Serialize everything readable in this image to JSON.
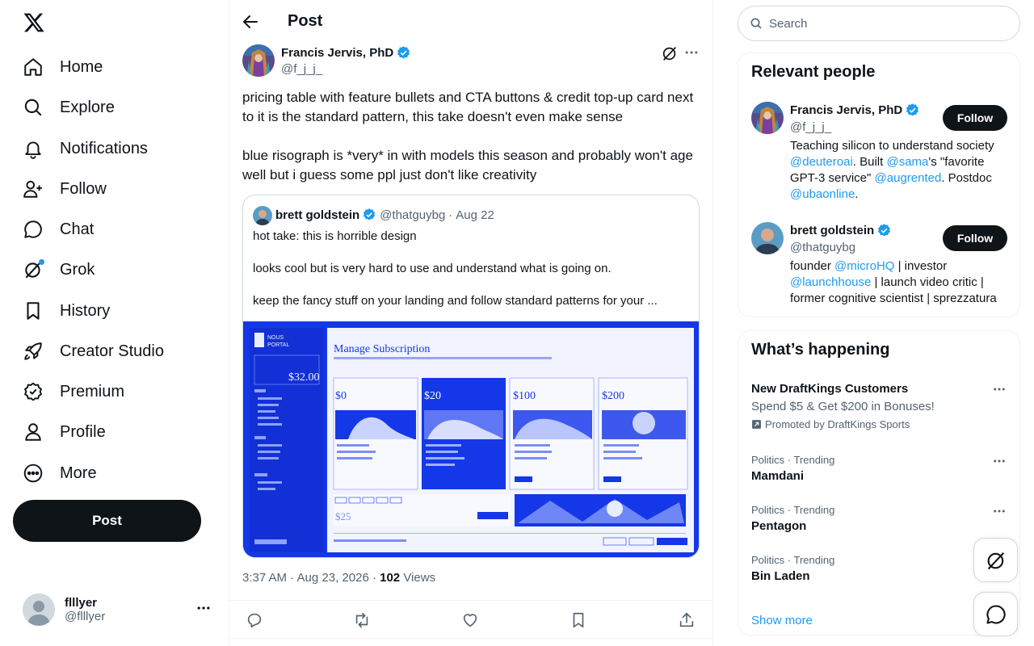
{
  "nav": {
    "items": [
      {
        "label": "Home",
        "icon": "home-icon"
      },
      {
        "label": "Explore",
        "icon": "search-icon"
      },
      {
        "label": "Notifications",
        "icon": "bell-icon"
      },
      {
        "label": "Follow",
        "icon": "person-plus-icon"
      },
      {
        "label": "Chat",
        "icon": "chat-icon"
      },
      {
        "label": "Grok",
        "icon": "grok-icon"
      },
      {
        "label": "History",
        "icon": "bookmark-icon"
      },
      {
        "label": "Creator Studio",
        "icon": "rocket-icon"
      },
      {
        "label": "Premium",
        "icon": "verified-badge-icon"
      },
      {
        "label": "Profile",
        "icon": "person-icon"
      },
      {
        "label": "More",
        "icon": "more-circle-icon"
      }
    ],
    "post_label": "Post",
    "account": {
      "name": "flllyer",
      "handle": "@flllyer"
    }
  },
  "header": {
    "title": "Post"
  },
  "tweet": {
    "author_name": "Francis Jervis, PhD",
    "author_handle": "@f_j_j_",
    "text": "pricing table with feature bullets and CTA buttons & credit top-up card next to it is the standard pattern, this take doesn't even make sense\n\nblue risograph is *very* in with models this season and probably won't age well but i guess some ppl just don't like creativity",
    "timestamp": "3:37 AM · Aug 23, 2026 · ",
    "views_count": "102",
    "views_label": "Views"
  },
  "quote": {
    "author_name": "brett goldstein",
    "author_handle": "@thatguybg",
    "separator": "·",
    "date": "Aug 22",
    "lines": [
      "hot take: this is horrible design",
      "looks cool but is very hard to use and understand what is going on.",
      "keep the fancy stuff on your landing and follow standard patterns for your ..."
    ],
    "image": {
      "logo_lines": [
        "NOUS",
        "PORTAL"
      ],
      "heading": "Manage Subscription",
      "balance": "$32.00",
      "prices": [
        "$0",
        "$20",
        "$100",
        "$200"
      ],
      "topup": "$25"
    }
  },
  "right": {
    "search_placeholder": "Search",
    "relevant_title": "Relevant people",
    "people": [
      {
        "name": "Francis Jervis, PhD",
        "handle": "@f_j_j_",
        "follow_label": "Follow",
        "bio": [
          {
            "t": "Teaching silicon to understand society "
          },
          {
            "t": "@deuteroai",
            "m": true
          },
          {
            "t": ". Built "
          },
          {
            "t": "@sama",
            "m": true
          },
          {
            "t": "'s \"favorite GPT-3 service\" "
          },
          {
            "t": "@augrented",
            "m": true
          },
          {
            "t": ". Postdoc "
          },
          {
            "t": "@ubaonline",
            "m": true
          },
          {
            "t": "."
          }
        ]
      },
      {
        "name": "brett goldstein",
        "handle": "@thatguybg",
        "follow_label": "Follow",
        "bio": [
          {
            "t": "founder "
          },
          {
            "t": "@microHQ",
            "m": true
          },
          {
            "t": " | investor "
          },
          {
            "t": "@launchhouse",
            "m": true
          },
          {
            "t": " | launch video critic | former cognitive scientist | sprezzatura"
          }
        ]
      }
    ],
    "happening_title": "What’s happening",
    "trends": [
      {
        "title": "New DraftKings Customers",
        "sub": "Spend $5 & Get $200 in Bonuses!",
        "promo": "Promoted by DraftKings Sports"
      },
      {
        "meta": "Politics · Trending",
        "title": "Mamdani"
      },
      {
        "meta": "Politics · Trending",
        "title": "Pentagon"
      },
      {
        "meta": "Politics · Trending",
        "title": "Bin Laden"
      }
    ],
    "show_more": "Show more"
  },
  "colors": {
    "accent": "#1d9bf0",
    "text": "#0f1419",
    "muted": "#536471",
    "risograph_blue": "#1438e8"
  }
}
